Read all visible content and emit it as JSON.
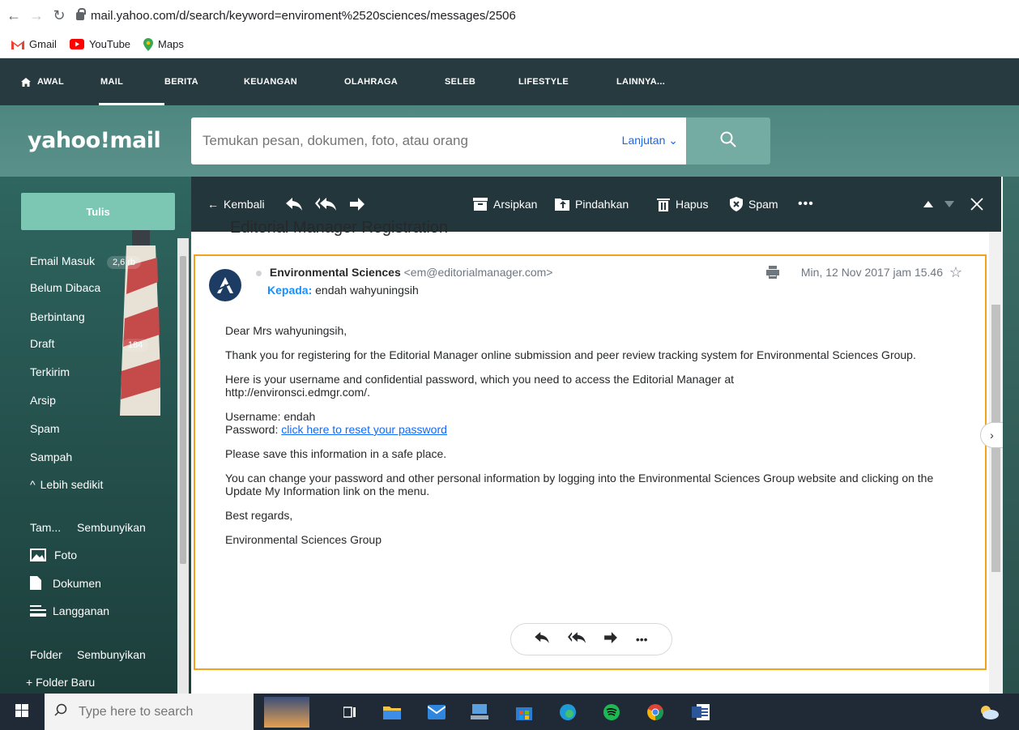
{
  "browser": {
    "url": "mail.yahoo.com/d/search/keyword=enviroment%2520sciences/messages/2506",
    "bookmarks": [
      {
        "label": "Gmail"
      },
      {
        "label": "YouTube"
      },
      {
        "label": "Maps"
      }
    ]
  },
  "yahoo_nav": {
    "items": [
      "AWAL",
      "MAIL",
      "BERITA",
      "KEUANGAN",
      "OLAHRAGA",
      "SELEB",
      "LIFESTYLE",
      "LAINNYA..."
    ],
    "active": "MAIL"
  },
  "header": {
    "logo": "yahoo!mail",
    "search_placeholder": "Temukan pesan, dokumen, foto, atau orang",
    "advanced_label": "Lanjutan"
  },
  "sidebar": {
    "compose_label": "Tulis",
    "folders": [
      {
        "label": "Email Masuk",
        "count": "2,6 rb"
      },
      {
        "label": "Belum Dibaca",
        "count": ""
      },
      {
        "label": "Berbintang",
        "count": ""
      },
      {
        "label": "Draft",
        "count": "184"
      },
      {
        "label": "Terkirim",
        "count": ""
      },
      {
        "label": "Arsip",
        "count": ""
      },
      {
        "label": "Spam",
        "count": ""
      },
      {
        "label": "Sampah",
        "count": ""
      }
    ],
    "less_label": "Lebih sedikit",
    "views_label": "Tam...",
    "views_hide": "Sembunyikan",
    "views": [
      {
        "label": "Foto"
      },
      {
        "label": "Dokumen"
      },
      {
        "label": "Langganan"
      }
    ],
    "folders_label": "Folder",
    "folders_hide": "Sembunyikan",
    "new_folder": "+ Folder Baru"
  },
  "toolbar": {
    "back": "Kembali",
    "archive": "Arsipkan",
    "move": "Pindahkan",
    "delete": "Hapus",
    "spam": "Spam",
    "more": "•••"
  },
  "message": {
    "subject": "Editorial Manager Registration",
    "sender_name": "Environmental Sciences",
    "sender_email": "<em@editorialmanager.com>",
    "to_label": "Kepada:",
    "to_value": "endah wahyuningsih",
    "date": "Min, 12 Nov 2017 jam 15.46",
    "body": {
      "greeting": "Dear Mrs wahyuningsih,",
      "p1": "Thank you for registering for the Editorial Manager online submission and peer review tracking system for Environmental Sciences Group.",
      "p2a": "Here is your username and confidential password, which you need to access the Editorial Manager at",
      "p2b": "http://environsci.edmgr.com/.",
      "username": "Username: endah",
      "password_label": "Password:",
      "password_link": "click here to reset your password",
      "p3": "Please save this information in a safe place.",
      "p4": "You can change your password and other personal information by logging into the Environmental Sciences Group website and clicking on the Update My Information link on the menu.",
      "regards": "Best regards,",
      "signature": "Environmental Sciences Group"
    }
  },
  "taskbar": {
    "search_placeholder": "Type here to search"
  },
  "colors": {
    "nav_bg": "#263a3f",
    "header_bg": "#5a918a",
    "compose": "#7cc7b3",
    "selected_border": "#f2a31b",
    "link": "#0f69ff"
  }
}
